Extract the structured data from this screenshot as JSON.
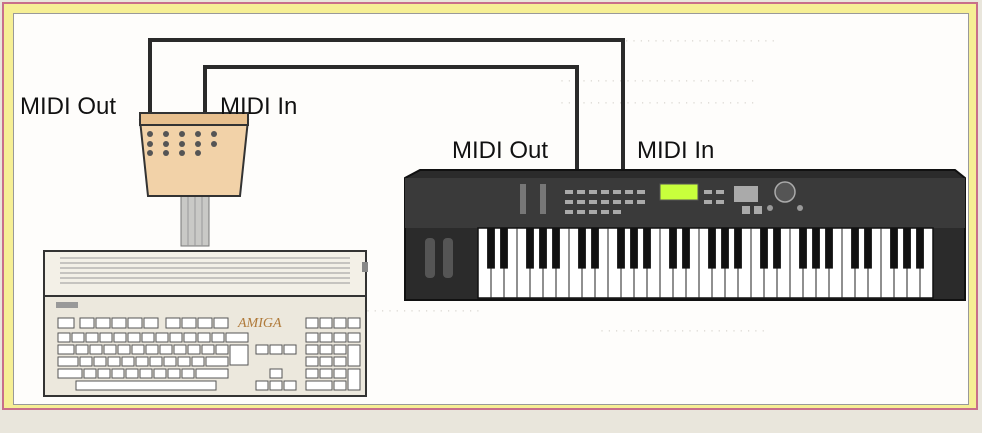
{
  "labels": {
    "interface_out": "MIDI Out",
    "interface_in": "MIDI In",
    "keyboard_out": "MIDI Out",
    "keyboard_in": "MIDI In"
  },
  "computer": {
    "brand": "AMIGA"
  },
  "colors": {
    "frame_background": "#f6ef95",
    "frame_border": "#c86f8a",
    "cable": "#2a2a2a",
    "interface_box": "#f2d2a8",
    "keyboard_body": "#2b2b2b",
    "display": "#c8ff3c",
    "computer_body": "#f3f0e7"
  }
}
